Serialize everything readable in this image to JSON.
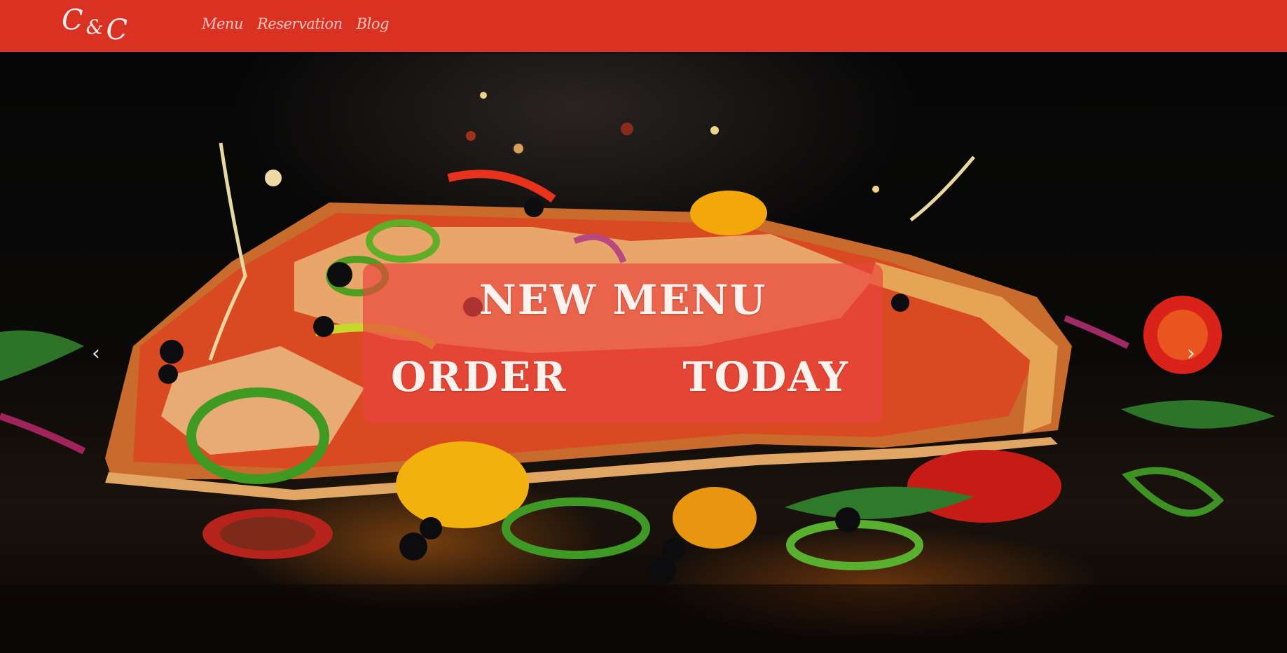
{
  "brand": {
    "letter1": "C",
    "ampersand": "&",
    "letter2": "C"
  },
  "nav": {
    "items": [
      {
        "label": "Menu"
      },
      {
        "label": "Reservation"
      },
      {
        "label": "Blog"
      }
    ]
  },
  "hero": {
    "caption_line1": "NEW MENU",
    "caption_word1": "ORDER",
    "caption_word2": "TODAY",
    "prev_icon": "‹",
    "next_icon": "›"
  },
  "colors": {
    "navbar": "#d93223",
    "caption_box": "rgba(234,68,60,0.68)",
    "nav_text": "#f5c6c0"
  }
}
